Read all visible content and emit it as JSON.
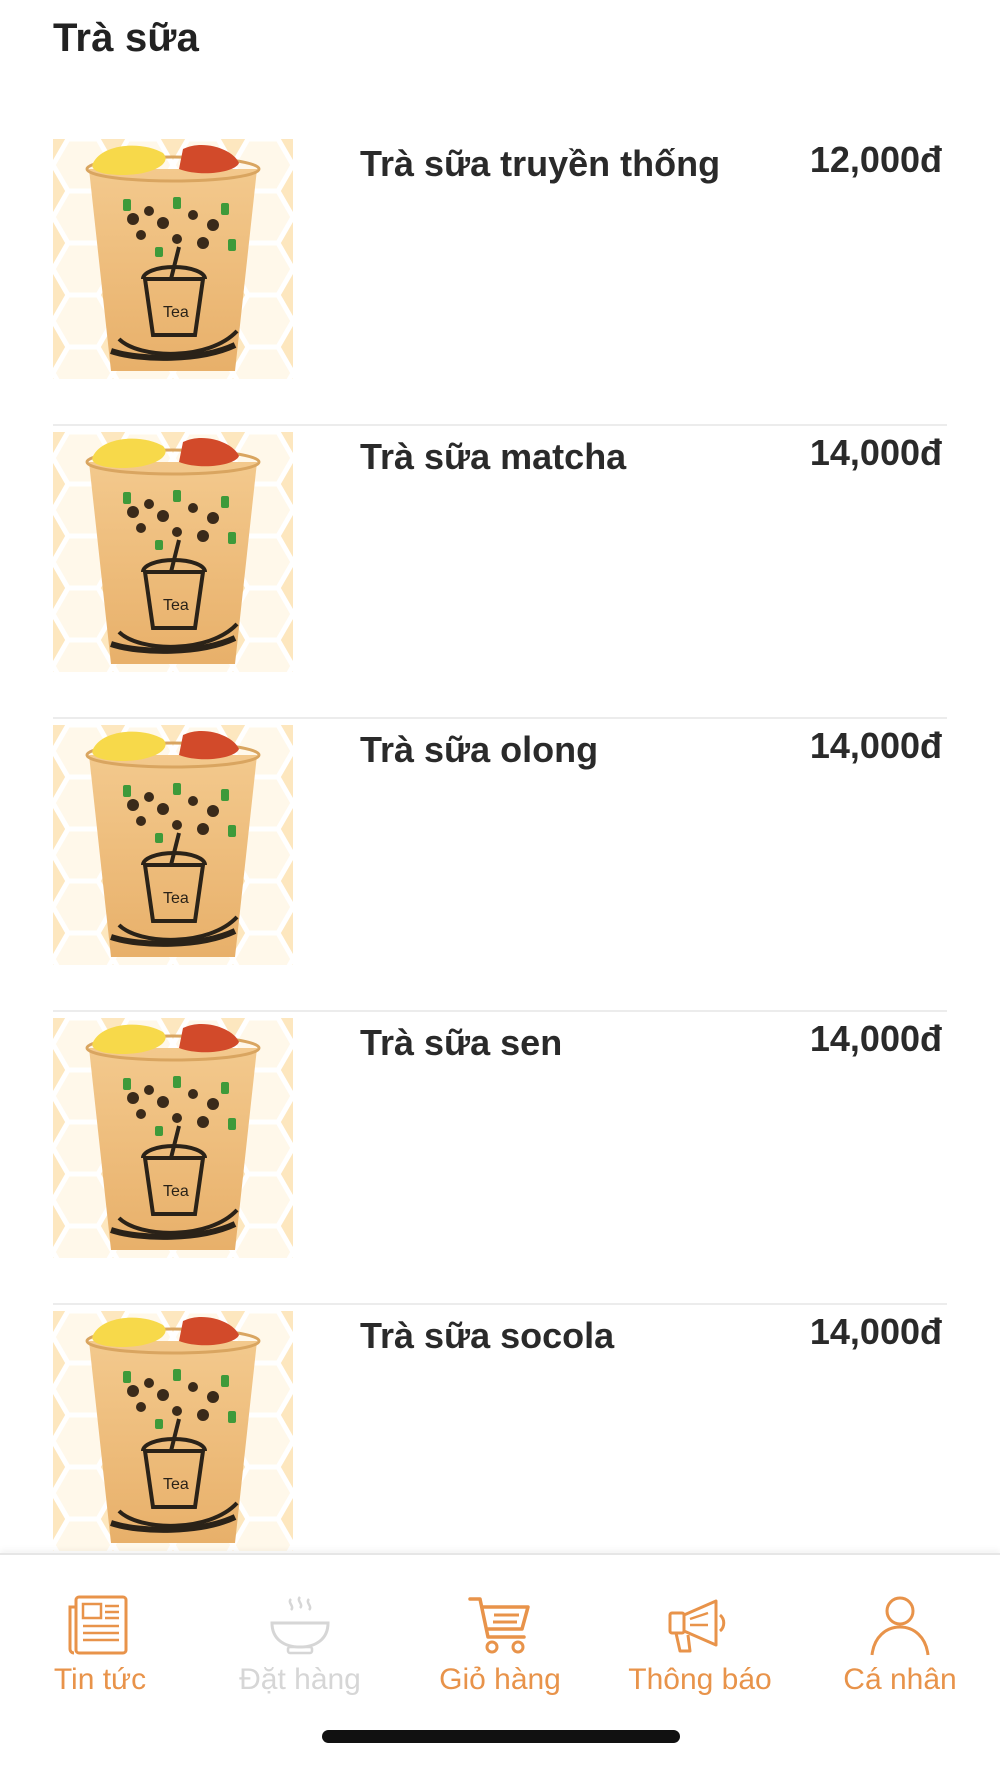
{
  "header": {
    "title": "Trà sữa"
  },
  "products": [
    {
      "name": "Trà sữa truyền thống",
      "price": "12,000đ"
    },
    {
      "name": "Trà sữa matcha",
      "price": "14,000đ"
    },
    {
      "name": "Trà sữa olong",
      "price": "14,000đ"
    },
    {
      "name": "Trà sữa sen",
      "price": "14,000đ"
    },
    {
      "name": "Trà sữa socola",
      "price": "14,000đ"
    }
  ],
  "product_image": {
    "cup_text": "Tea"
  },
  "tabs": [
    {
      "label": "Tin tức",
      "icon": "newspaper-icon",
      "state": "enabled"
    },
    {
      "label": "Đặt hàng",
      "icon": "bowl-icon",
      "state": "disabled"
    },
    {
      "label": "Giỏ hàng",
      "icon": "cart-icon",
      "state": "enabled"
    },
    {
      "label": "Thông báo",
      "icon": "megaphone-icon",
      "state": "enabled"
    },
    {
      "label": "Cá nhân",
      "icon": "person-icon",
      "state": "enabled"
    }
  ],
  "colors": {
    "accent": "#e8934a",
    "disabled": "#d6d6d6",
    "text": "#2a2a2a",
    "divider": "#ececec",
    "image_background": "#fde7bf"
  }
}
